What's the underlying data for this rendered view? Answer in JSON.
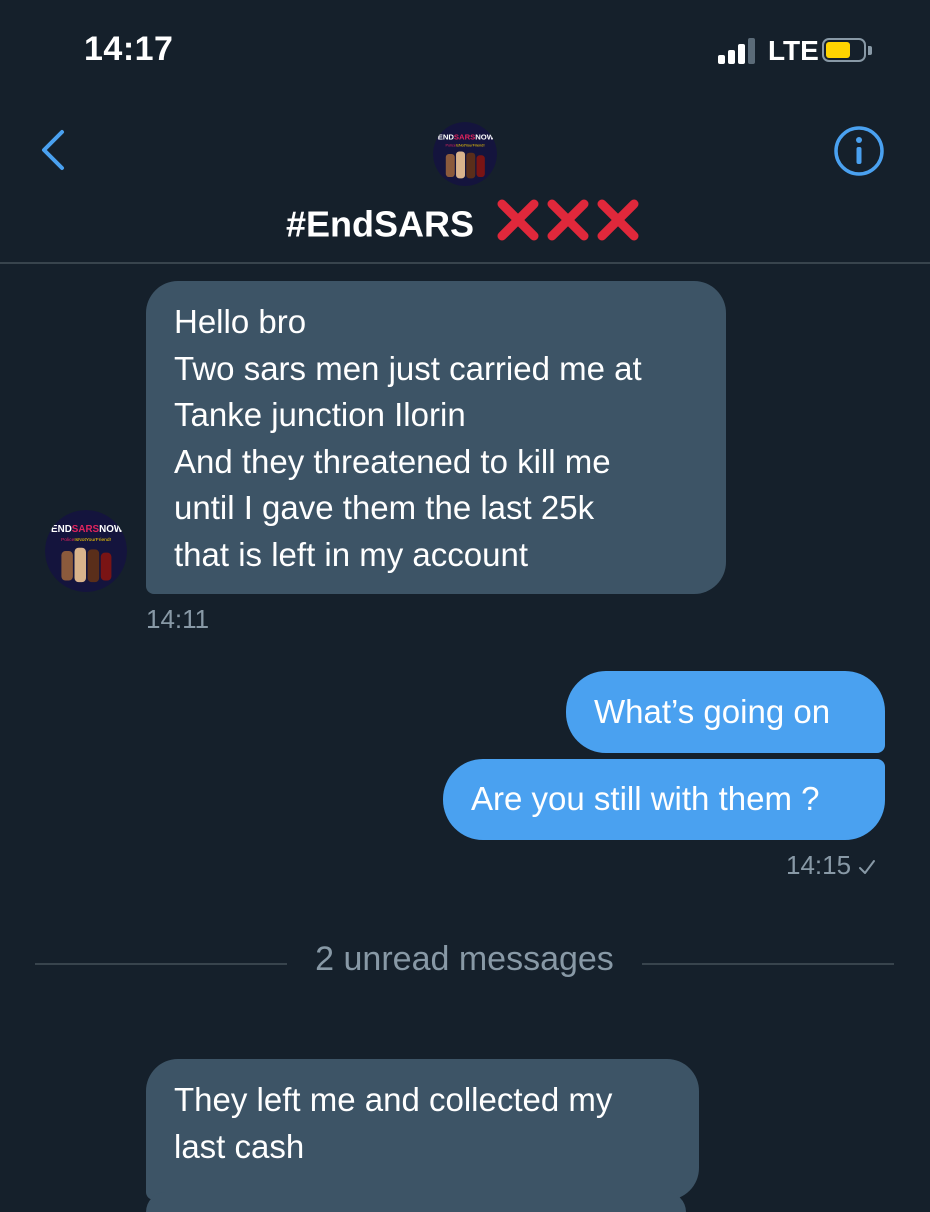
{
  "status_bar": {
    "time": "14:17",
    "network": "LTE",
    "battery_color": "#ffd400"
  },
  "header": {
    "title": "#EndSARS",
    "title_marks": "❌❌❌",
    "back_icon": "chevron-left-icon",
    "info_icon": "info-icon",
    "accent_color": "#4aa1f0"
  },
  "avatar": {
    "line1_a": "#END",
    "line1_b": "SARS",
    "line1_c": "NOW!",
    "line2_a": "Police",
    "line2_b": "IsNotYourFriend!"
  },
  "messages": {
    "incoming_1": {
      "lines": [
        "Hello bro",
        "Two sars men just carried me at",
        "Tanke junction Ilorin",
        "And they threatened to kill me",
        "until I gave them the last 25k",
        "that is left in my account"
      ],
      "time": "14:11"
    },
    "outgoing_1": {
      "text": "What’s going on"
    },
    "outgoing_2": {
      "text": "Are you still with them ?",
      "time": "14:15"
    },
    "unread_label": "2 unread messages",
    "incoming_2": {
      "lines": [
        "They left me and collected my",
        "last cash"
      ]
    }
  }
}
